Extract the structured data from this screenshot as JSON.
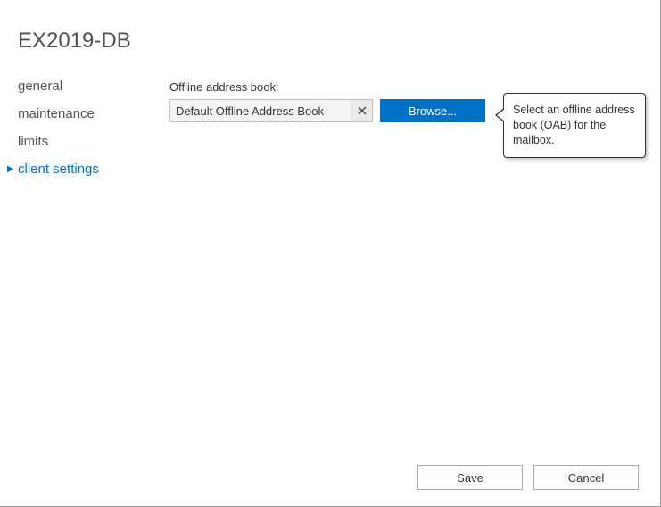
{
  "title": "EX2019-DB",
  "sidebar": {
    "items": [
      {
        "label": "general",
        "active": false
      },
      {
        "label": "maintenance",
        "active": false
      },
      {
        "label": "limits",
        "active": false
      },
      {
        "label": "client settings",
        "active": true
      }
    ]
  },
  "main": {
    "oab_label": "Offline address book:",
    "oab_value": "Default Offline Address Book",
    "browse_label": "Browse..."
  },
  "tooltip": {
    "text": "Select an offline address book (OAB) for the mailbox."
  },
  "footer": {
    "save_label": "Save",
    "cancel_label": "Cancel"
  }
}
